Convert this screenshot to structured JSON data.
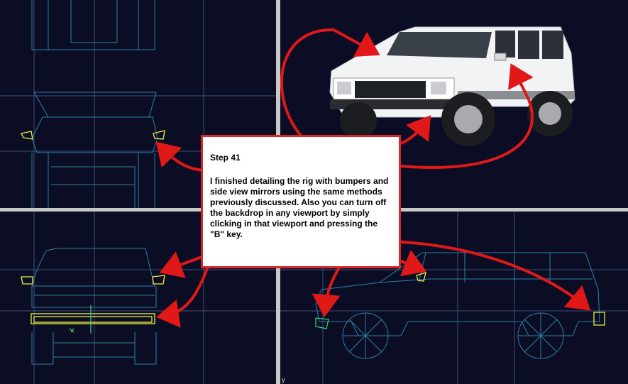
{
  "note": {
    "title": "Step 41",
    "body": "I finished detailing the rig with bumpers and side view mirrors using the same methods previously discussed. Also you can turn off the backdrop in any viewport by simply clicking in that viewport and pressing the \"B\" key."
  },
  "viewport_axis_label": "y",
  "colors": {
    "viewport_bg": "#0a0d24",
    "wireframe": "#2e7fa8",
    "selected": "#f2f040",
    "arrow": "#e01818",
    "divider": "#c8c8c8"
  }
}
